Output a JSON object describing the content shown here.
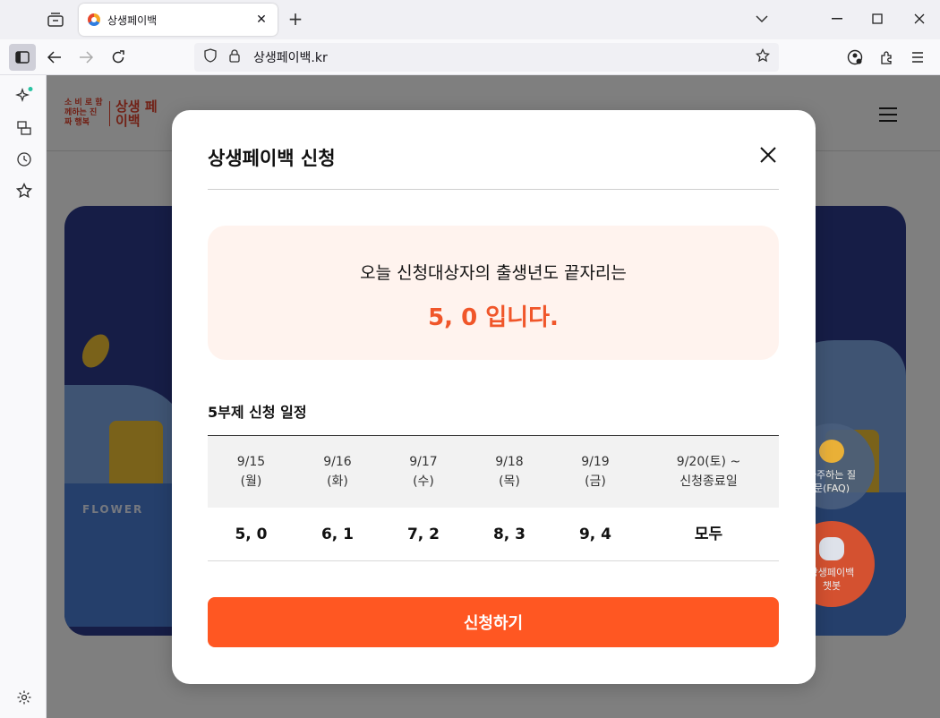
{
  "browser": {
    "tab_title": "상생페이백",
    "url": "상생페이백.kr"
  },
  "page": {
    "logo_small": "소 비 로 함께하는 진짜 행복",
    "logo_big": "상생 페이백",
    "banner_sign": "FLOWER",
    "fab_faq": "자주하는 질문(FAQ)",
    "fab_chatbot": "상생페이백 챗봇"
  },
  "modal": {
    "title": "상생페이백 신청",
    "notice_line1": "오늘 신청대상자의 출생년도 끝자리는",
    "notice_line2": "5, 0 입니다.",
    "schedule_title": "5부제 신청 일정",
    "schedule": [
      {
        "date": "9/15",
        "day": "(월)",
        "digits": "5, 0"
      },
      {
        "date": "9/16",
        "day": "(화)",
        "digits": "6, 1"
      },
      {
        "date": "9/17",
        "day": "(수)",
        "digits": "7, 2"
      },
      {
        "date": "9/18",
        "day": "(목)",
        "digits": "8, 3"
      },
      {
        "date": "9/19",
        "day": "(금)",
        "digits": "9, 4"
      },
      {
        "date": "9/20(토) ~",
        "day": "신청종료일",
        "digits": "모두"
      }
    ],
    "apply_label": "신청하기"
  },
  "colors": {
    "accent": "#ff5722",
    "notice_bg": "#fff3ee",
    "highlight_text": "#f0562a"
  }
}
